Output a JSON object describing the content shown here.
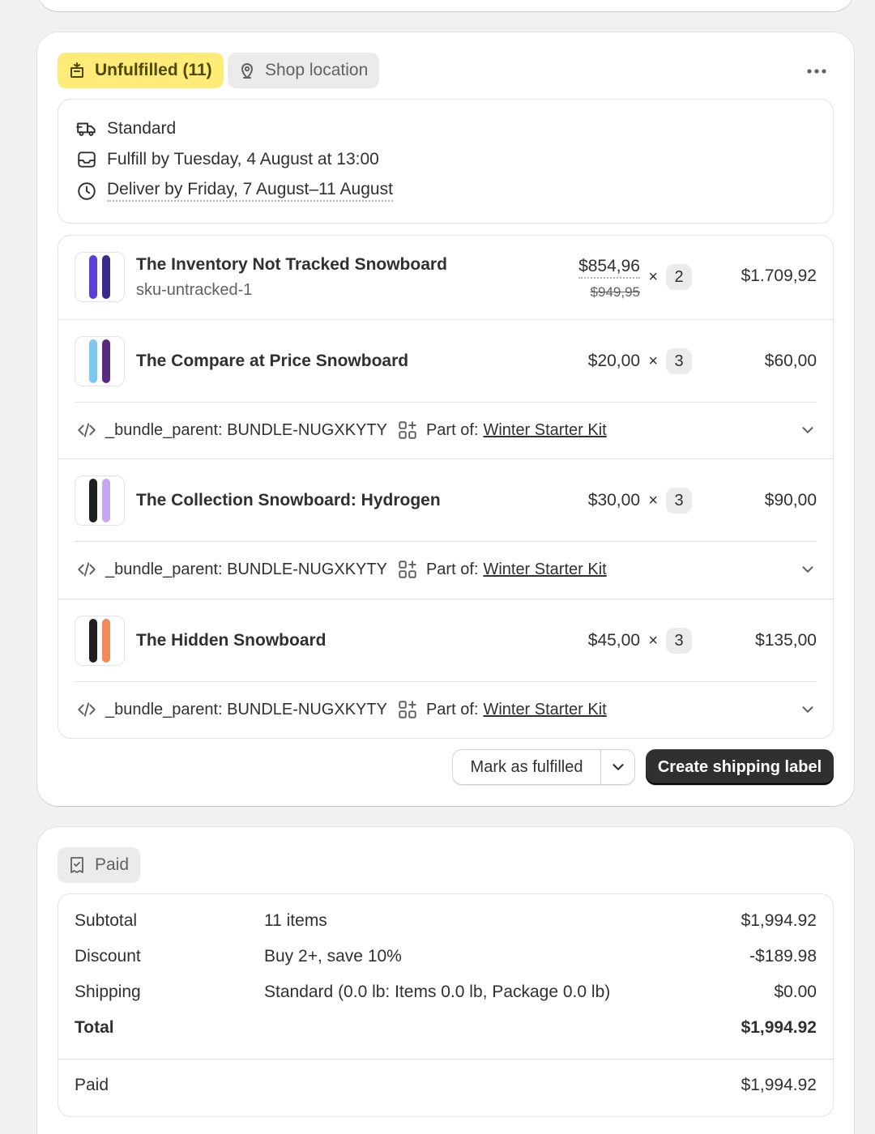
{
  "fulfillment": {
    "status_badge": "Unfulfilled (11)",
    "location_badge": "Shop location",
    "shipping": {
      "method": "Standard",
      "fulfill_by": "Fulfill by Tuesday, 4 August at 13:00",
      "deliver_by": "Deliver by Friday, 7 August–11 August"
    },
    "items": [
      {
        "title": "The Inventory Not Tracked Snowboard",
        "sku": "sku-untracked-1",
        "price": "$854,96",
        "original_price": "$949,95",
        "times": "×",
        "qty": "2",
        "total": "$1.709,92",
        "board_colors": [
          "#5b3fd6",
          "#3a2a8c"
        ]
      },
      {
        "title": "The Compare at Price Snowboard",
        "price": "$20,00",
        "times": "×",
        "qty": "3",
        "total": "$60,00",
        "board_colors": [
          "#7ec8f0",
          "#5a2a7c"
        ],
        "bundle": {
          "property": "_bundle_parent: BUNDLE-NUGXKYTY",
          "part_of_label": "Part of:",
          "part_of_link": "Winter Starter Kit"
        }
      },
      {
        "title": "The Collection Snowboard: Hydrogen",
        "price": "$30,00",
        "times": "×",
        "qty": "3",
        "total": "$90,00",
        "board_colors": [
          "#1f1f1f",
          "#c9a6f0"
        ],
        "bundle": {
          "property": "_bundle_parent: BUNDLE-NUGXKYTY",
          "part_of_label": "Part of:",
          "part_of_link": "Winter Starter Kit"
        }
      },
      {
        "title": "The Hidden Snowboard",
        "price": "$45,00",
        "times": "×",
        "qty": "3",
        "total": "$135,00",
        "board_colors": [
          "#1f1f1f",
          "#f08a5a"
        ],
        "bundle": {
          "property": "_bundle_parent: BUNDLE-NUGXKYTY",
          "part_of_label": "Part of:",
          "part_of_link": "Winter Starter Kit"
        }
      }
    ],
    "actions": {
      "mark_fulfilled": "Mark as fulfilled",
      "create_label": "Create shipping label"
    }
  },
  "payment": {
    "badge": "Paid",
    "rows": [
      {
        "label": "Subtotal",
        "desc": "11 items",
        "amount": "$1,994.92"
      },
      {
        "label": "Discount",
        "desc": "Buy 2+, save 10%",
        "amount": "-$189.98"
      },
      {
        "label": "Shipping",
        "desc": "Standard (0.0 lb: Items 0.0 lb, Package 0.0 lb)",
        "amount": "$0.00"
      },
      {
        "label": "Total",
        "desc": "",
        "amount": "$1,994.92"
      }
    ],
    "paid": {
      "label": "Paid",
      "amount": "$1,994.92"
    }
  },
  "icons": {
    "fulfill_badge": "package-icon",
    "location": "location-pin-icon",
    "more": "more-horizontal-icon",
    "shipping": "truck-icon",
    "fulfill_by": "inbox-icon",
    "deliver_by": "clock-icon",
    "bundle_property": "code-icon",
    "part_of": "apps-add-icon",
    "expand": "chevron-down-icon",
    "paid": "receipt-check-icon"
  },
  "colors": {
    "unfulfilled_badge_bg": "#ffeb78",
    "primary_button_bg": "#303030",
    "page_bg": "#f1f1f1"
  }
}
